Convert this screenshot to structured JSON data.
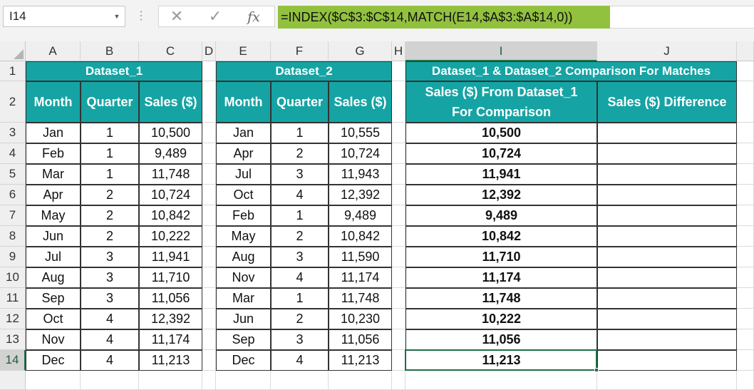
{
  "name_box": {
    "value": "I14"
  },
  "formula_bar": {
    "formula": "=INDEX($C$3:$C$14,MATCH(E14,$A$3:$A$14,0))",
    "cancel_glyph": "✕",
    "enter_glyph": "✓",
    "fx_label": "fx"
  },
  "columns": [
    "A",
    "B",
    "C",
    "D",
    "E",
    "F",
    "G",
    "H",
    "I",
    "J"
  ],
  "rows": [
    "1",
    "2",
    "3",
    "4",
    "5",
    "6",
    "7",
    "8",
    "9",
    "10",
    "11",
    "12",
    "13",
    "14"
  ],
  "dataset1": {
    "title": "Dataset_1",
    "headers": [
      "Month",
      "Quarter",
      "Sales ($)"
    ],
    "rows": [
      [
        "Jan",
        "1",
        "10,500"
      ],
      [
        "Feb",
        "1",
        "9,489"
      ],
      [
        "Mar",
        "1",
        "11,748"
      ],
      [
        "Apr",
        "2",
        "10,724"
      ],
      [
        "May",
        "2",
        "10,842"
      ],
      [
        "Jun",
        "2",
        "10,222"
      ],
      [
        "Jul",
        "3",
        "11,941"
      ],
      [
        "Aug",
        "3",
        "11,710"
      ],
      [
        "Sep",
        "3",
        "11,056"
      ],
      [
        "Oct",
        "4",
        "12,392"
      ],
      [
        "Nov",
        "4",
        "11,174"
      ],
      [
        "Dec",
        "4",
        "11,213"
      ]
    ]
  },
  "dataset2": {
    "title": "Dataset_2",
    "headers": [
      "Month",
      "Quarter",
      "Sales ($)"
    ],
    "rows": [
      [
        "Jan",
        "1",
        "10,555"
      ],
      [
        "Apr",
        "2",
        "10,724"
      ],
      [
        "Jul",
        "3",
        "11,943"
      ],
      [
        "Oct",
        "4",
        "12,392"
      ],
      [
        "Feb",
        "1",
        "9,489"
      ],
      [
        "May",
        "2",
        "10,842"
      ],
      [
        "Aug",
        "3",
        "11,590"
      ],
      [
        "Nov",
        "4",
        "11,174"
      ],
      [
        "Mar",
        "1",
        "11,748"
      ],
      [
        "Jun",
        "2",
        "10,230"
      ],
      [
        "Sep",
        "3",
        "11,056"
      ],
      [
        "Dec",
        "4",
        "11,213"
      ]
    ]
  },
  "comparison": {
    "title": "Dataset_1 & Dataset_2 Comparison For Matches",
    "header_i_line1": "Sales ($) From Dataset_1",
    "header_i_line2": "For Comparison",
    "header_j": "Sales ($) Difference",
    "values": [
      "10,500",
      "10,724",
      "11,941",
      "12,392",
      "9,489",
      "10,842",
      "11,710",
      "11,174",
      "11,748",
      "10,222",
      "11,056",
      "11,213"
    ],
    "differences": [
      "",
      "",
      "",
      "",
      "",
      "",
      "",
      "",
      "",
      "",
      "",
      ""
    ]
  },
  "selection": {
    "cell": "I14",
    "column": "I",
    "row": "14"
  },
  "colors": {
    "header_teal": "#16a3a3",
    "formula_highlight": "#92c13e",
    "selection_green": "#217346"
  }
}
